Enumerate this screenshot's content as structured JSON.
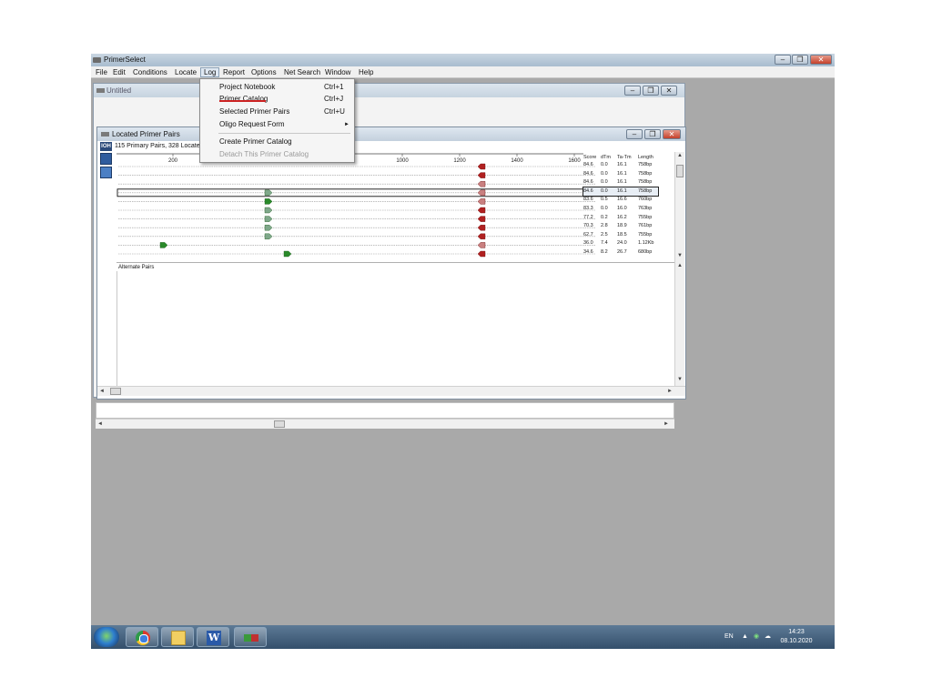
{
  "app": {
    "title": "PrimerSelect"
  },
  "menubar": [
    "File",
    "Edit",
    "Conditions",
    "Locate",
    "Log",
    "Report",
    "Options",
    "Net Search",
    "Window",
    "Help"
  ],
  "window_untitled": {
    "title": "Untitled"
  },
  "window_located": {
    "title": "Located Primer Pairs",
    "badge": "IOH",
    "summary": "115 Primary Pairs, 328 Located"
  },
  "log_menu": {
    "items": [
      {
        "label": "Project Notebook",
        "shortcut": "Ctrl+1"
      },
      {
        "label": "Primer Catalog",
        "shortcut": "Ctrl+J"
      },
      {
        "label": "Selected Primer Pairs",
        "shortcut": "Ctrl+U"
      },
      {
        "label": "Oligo Request Form",
        "submenu": "►"
      },
      {
        "label": "Create Primer Catalog"
      },
      {
        "label": "Detach This Primer Catalog",
        "disabled": true
      }
    ]
  },
  "ruler": {
    "ticks": [
      "200",
      "1000",
      "1200",
      "1400",
      "1600"
    ]
  },
  "score_table": {
    "headers": [
      "Score",
      "dTm",
      "Ta-Tm",
      "Length"
    ],
    "rows": [
      [
        "84.6",
        "0.0",
        "16.1",
        "758bp"
      ],
      [
        "84.6",
        "0.0",
        "16.1",
        "758bp"
      ],
      [
        "84.6",
        "0.0",
        "16.1",
        "758bp"
      ],
      [
        "84.6",
        "0.0",
        "16.1",
        "758bp"
      ],
      [
        "83.6",
        "0.5",
        "16.6",
        "760bp"
      ],
      [
        "83.3",
        "0.0",
        "16.0",
        "763bp"
      ],
      [
        "77.2",
        "0.2",
        "16.2",
        "755bp"
      ],
      [
        "70.3",
        "2.8",
        "18.9",
        "761bp"
      ],
      [
        "62.7",
        "2.5",
        "18.5",
        "755bp"
      ],
      [
        "36.0",
        "7.4",
        "24.0",
        "1.12Kb"
      ],
      [
        "34.6",
        "8.2",
        "26.7",
        "680bp"
      ]
    ]
  },
  "alternate_pairs_label": "Alternate Pairs",
  "taskbar": {
    "language": "EN",
    "time": "14:23",
    "date": "08.10.2020"
  },
  "colors": {
    "forward_primer": "#2a8a2a",
    "reverse_primer": "#b02020",
    "selected_row_primer": "#7fa88a"
  }
}
